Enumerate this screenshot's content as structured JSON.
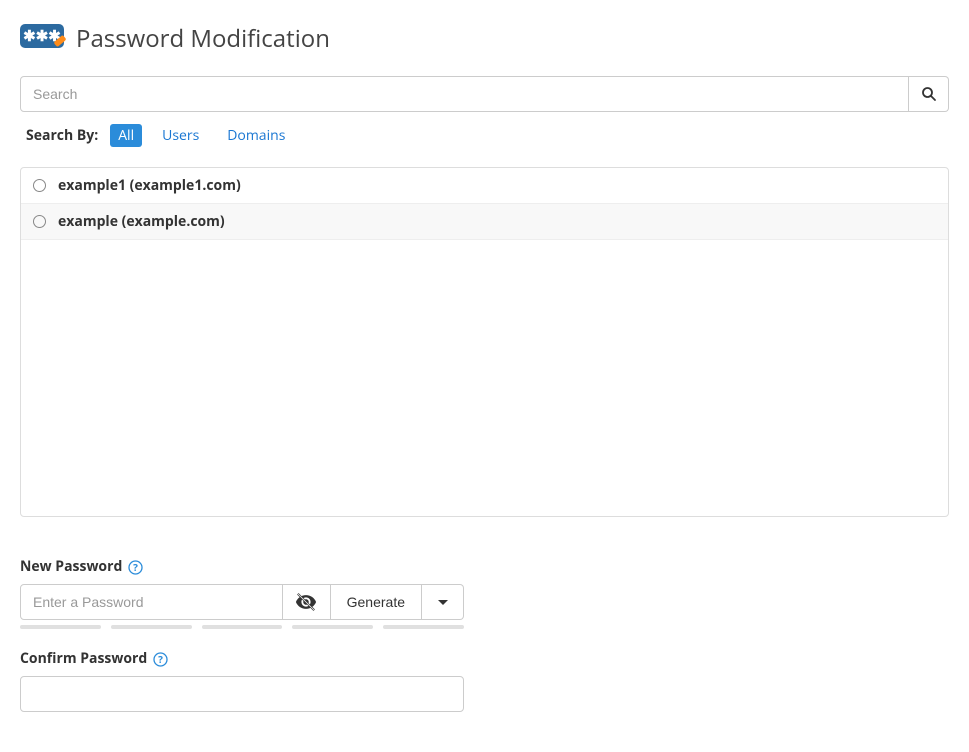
{
  "header": {
    "title": "Password Modification"
  },
  "search": {
    "placeholder": "Search",
    "filter_label": "Search By:",
    "filters": [
      {
        "label": "All",
        "active": true
      },
      {
        "label": "Users",
        "active": false
      },
      {
        "label": "Domains",
        "active": false
      }
    ]
  },
  "users": [
    {
      "label": "example1 (example1.com)"
    },
    {
      "label": "example (example.com)"
    }
  ],
  "form": {
    "new_password_label": "New Password",
    "new_password_placeholder": "Enter a Password",
    "generate_label": "Generate",
    "confirm_label": "Confirm Password"
  }
}
